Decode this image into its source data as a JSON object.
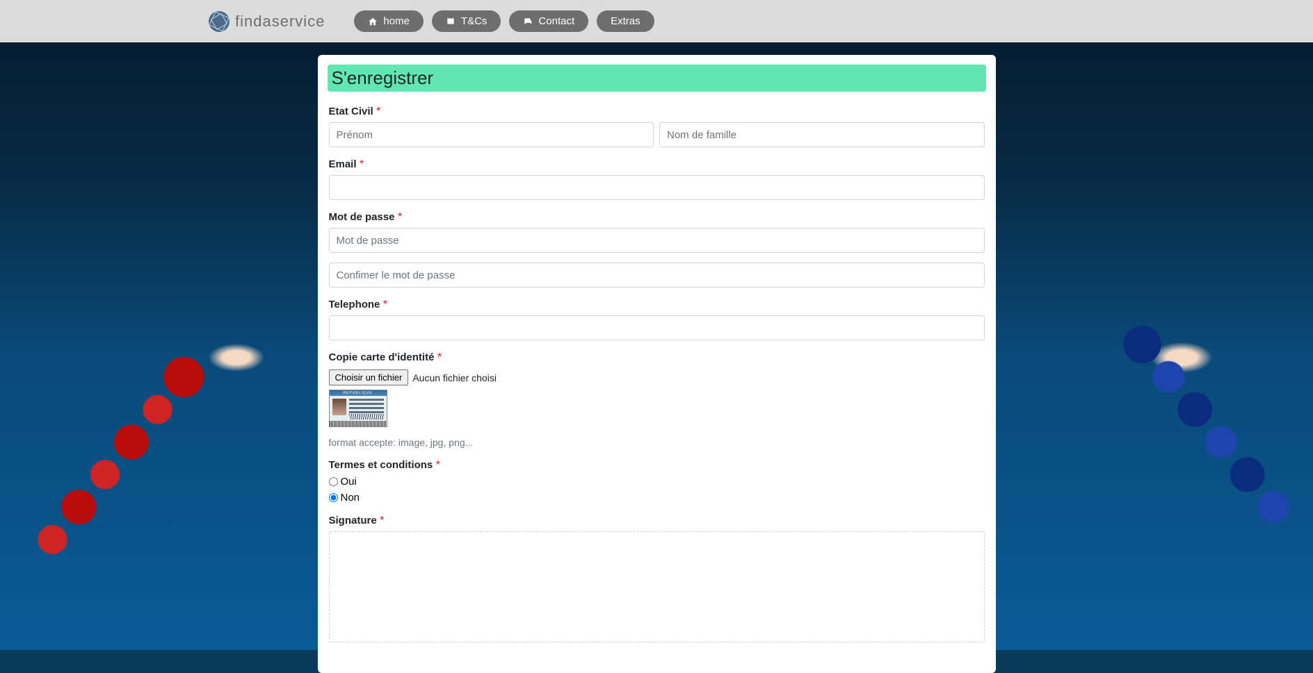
{
  "brand": {
    "name": "findaservice"
  },
  "nav": {
    "home": {
      "label": "home"
    },
    "tcs": {
      "label": "T&Cs"
    },
    "contact": {
      "label": "Contact"
    },
    "extras": {
      "label": "Extras"
    }
  },
  "page": {
    "title": "S'enregistrer"
  },
  "form": {
    "etat_civil": {
      "label": "Etat Civil",
      "firstname_placeholder": "Prénom",
      "lastname_placeholder": "Nom de famille"
    },
    "email": {
      "label": "Email"
    },
    "password": {
      "label": "Mot de passe",
      "placeholder": "Mot de passe",
      "confirm_placeholder": "Confimer le mot de passe"
    },
    "telephone": {
      "label": "Telephone"
    },
    "id_copy": {
      "label": "Copie carte d'identité",
      "choose_btn": "Choisir un fichier",
      "no_file": "Aucun fichier choisi",
      "hint": "format accepte: image, jpg, png..."
    },
    "terms": {
      "label": "Termes et conditions",
      "yes": "Oui",
      "no": "Non",
      "selected": "Non"
    },
    "signature": {
      "label": "Signature"
    },
    "required_mark": "*"
  }
}
